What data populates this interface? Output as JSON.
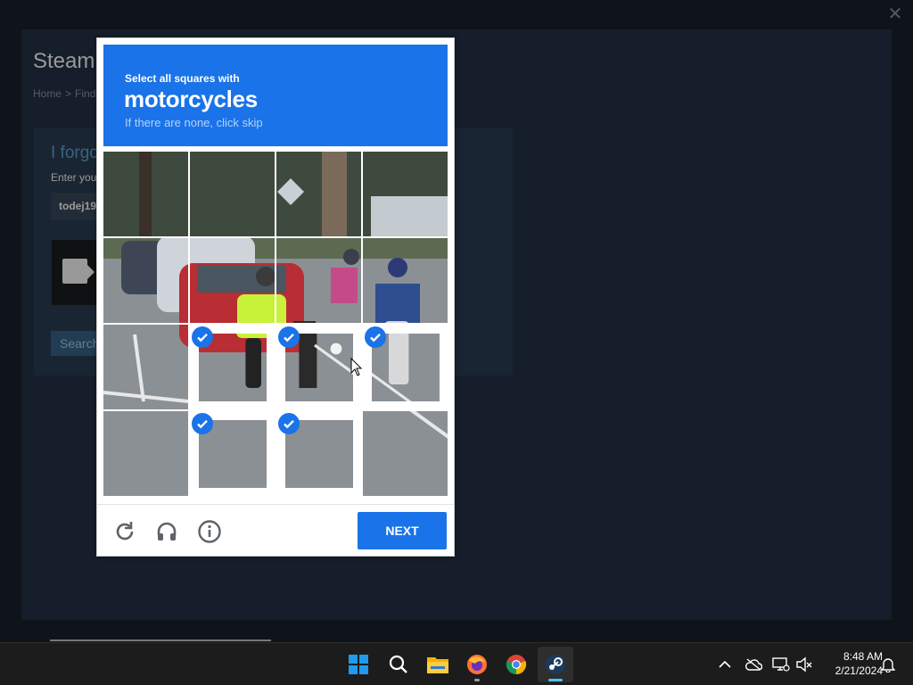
{
  "steam": {
    "title": "Steam",
    "close_glyph": "✕",
    "breadcrumb": [
      "Home",
      "Find"
    ],
    "breadcrumb_separator": ">",
    "form_heading": "I forgo",
    "form_label": "Enter you",
    "account_value": "todej19",
    "search_label": "Search"
  },
  "captcha": {
    "instruction": "Select all squares with",
    "target": "motorcycles",
    "hint": "If there are none, click skip",
    "next_label": "NEXT",
    "selected_tiles": [
      9,
      10,
      11,
      13,
      14
    ],
    "colors": {
      "accent": "#1a73e8",
      "header": "#1a73e8"
    }
  },
  "footer_icons": [
    "reload-icon",
    "audio-icon",
    "info-icon"
  ],
  "taskbar": {
    "apps": [
      "windows-start-icon",
      "search-icon",
      "file-explorer-icon",
      "firefox-icon",
      "chrome-icon",
      "steam-icon"
    ],
    "active_app": "steam-icon",
    "tray_icons": [
      "chevron-up-icon",
      "onedrive-icon",
      "network-icon",
      "volume-muted-icon",
      "notification-bell-icon"
    ],
    "time": "8:48 AM",
    "date": "2/21/2024"
  }
}
